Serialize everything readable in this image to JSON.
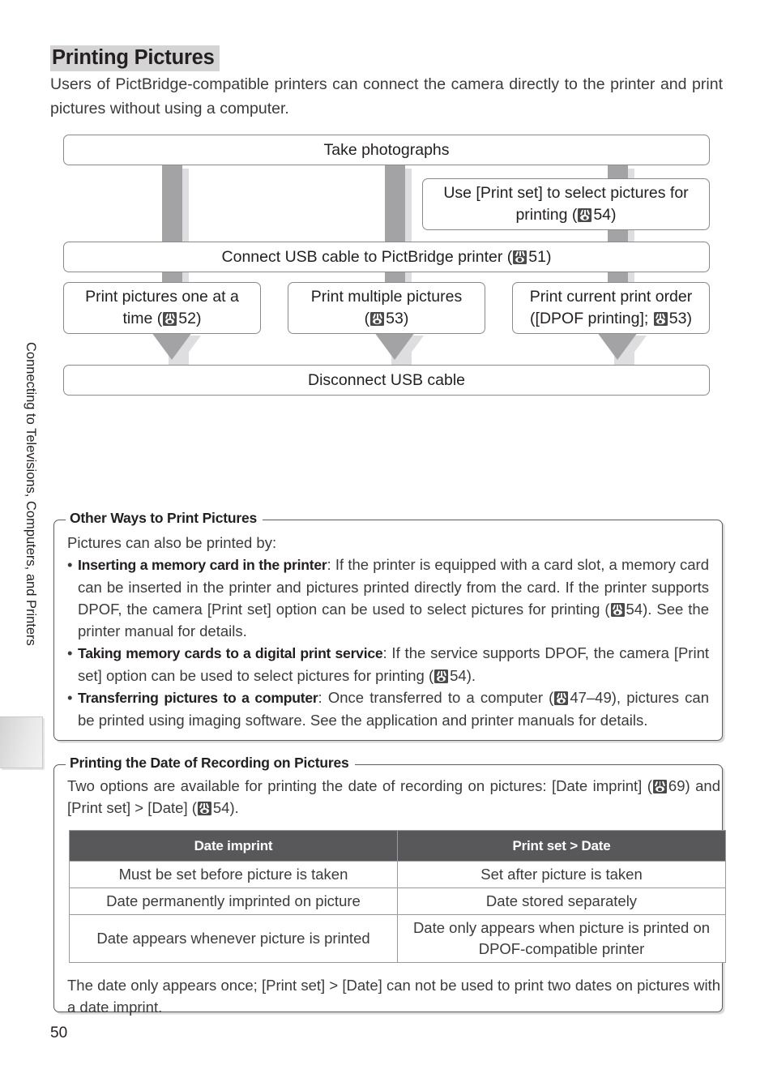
{
  "page": {
    "title": "Printing Pictures",
    "intro": "Users of PictBridge-compatible printers can connect the camera directly to the printer and print pictures without using a computer.",
    "number": "50",
    "chapter_tab": "Connecting to Televisions, Computers, and Printers"
  },
  "flowchart": {
    "boxes": {
      "take_photographs": "Take photographs",
      "print_set_select": {
        "line1": "Use [Print set] to select pictures for",
        "line2_pre": "printing (",
        "line2_page": "54",
        "line2_post": ")"
      },
      "connect_usb": {
        "pre": "Connect USB cable to PictBridge printer (",
        "page": "51",
        "post": ")"
      },
      "print_one": {
        "line1": "Print pictures one at a",
        "line2_pre": "time (",
        "line2_page": "52",
        "line2_post": ")"
      },
      "print_multiple": {
        "line1": "Print multiple pictures",
        "line2_pre": "(",
        "line2_page": "53",
        "line2_post": ")"
      },
      "print_order": {
        "line1": "Print current print order",
        "line2_pre": "([DPOF printing]; ",
        "line2_page": "53",
        "line2_post": ")"
      },
      "disconnect_usb": "Disconnect USB cable"
    }
  },
  "note_other_ways": {
    "title": "Other Ways to Print Pictures",
    "lead": "Pictures can also be printed by:",
    "bullets": [
      {
        "marker": "•",
        "bold": "Inserting a memory card in the printer",
        "text_a": ": If the printer is equipped with a card slot, a memory card can be inserted in the printer and pictures printed directly from the card.  If the printer supports DPOF, the camera [Print set] option can be used to select pictures for printing (",
        "page": "54",
        "text_b": ").  See the printer manual for details."
      },
      {
        "marker": "•",
        "bold": "Taking memory cards to a digital print service",
        "text_a": ": If the service supports DPOF, the camera [Print set] option can be used to select pictures for printing (",
        "page": "54",
        "text_b": ")."
      },
      {
        "marker": "•",
        "bold": "Transferring pictures to a computer",
        "text_a": ": Once transferred to a computer (",
        "page": "47–49",
        "text_b": "), pictures can be printed using imaging software.  See the application and printer manuals for details."
      }
    ]
  },
  "note_date_printing": {
    "title": "Printing the Date of Recording on Pictures",
    "lead_a": "Two options are available for printing the date of recording on pictures: [Date imprint] (",
    "lead_page1": "69",
    "lead_b": ") and [Print set] > [Date] (",
    "lead_page2": "54",
    "lead_c": ").",
    "table": {
      "headers": [
        "Date imprint",
        "Print set > Date"
      ],
      "rows": [
        [
          "Must be set before picture is taken",
          "Set after picture is taken"
        ],
        [
          "Date permanently imprinted on picture",
          "Date stored separately"
        ],
        [
          "Date appears whenever picture is printed",
          "Date only appears when picture is printed on DPOF-compatible printer"
        ]
      ]
    },
    "footer": "The date only appears once; [Print set] > [Date] can not be used to print two dates on pictures with a date imprint."
  }
}
